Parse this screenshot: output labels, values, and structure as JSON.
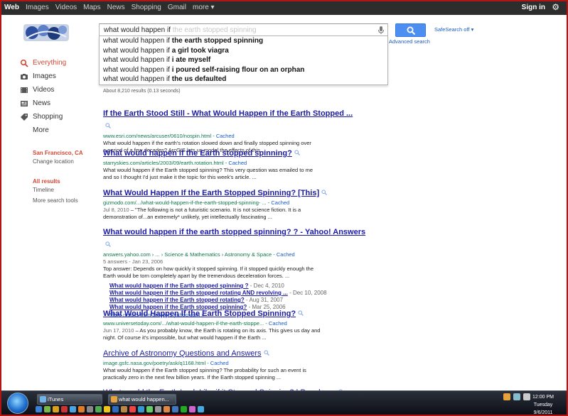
{
  "topbar": {
    "nav": [
      "Web",
      "Images",
      "Videos",
      "Maps",
      "News",
      "Shopping",
      "Gmail",
      "more ▾"
    ],
    "signin": "Sign in"
  },
  "search": {
    "typed": "what would happen if",
    "ghost": " the earth stopped spinning",
    "safesearch": "SafeSearch off ▾",
    "advanced": "Advanced search"
  },
  "suggestions": [
    {
      "prefix": "what would happen if ",
      "bold": "the earth stopped spinning"
    },
    {
      "prefix": "what would happen if ",
      "bold": "a girl took viagra"
    },
    {
      "prefix": "what would happen if ",
      "bold": "i ate myself"
    },
    {
      "prefix": "what would happen if ",
      "bold": "i poured self-raising flour on an orphan"
    },
    {
      "prefix": "what would happen if ",
      "bold": "the us defaulted"
    }
  ],
  "result_stats": "About 8,210 results (0.13 seconds)",
  "leftnav": {
    "items": [
      {
        "label": "Everything",
        "icon": "search-icon"
      },
      {
        "label": "Images",
        "icon": "camera-icon"
      },
      {
        "label": "Videos",
        "icon": "film-icon"
      },
      {
        "label": "News",
        "icon": "news-icon"
      },
      {
        "label": "Shopping",
        "icon": "tag-icon"
      },
      {
        "label": "More",
        "icon": ""
      }
    ],
    "location_city": "San Francisco, CA",
    "location_change": "Change location",
    "all_results": "All results",
    "timeline": "Timeline",
    "more_tools": "More search tools"
  },
  "results": [
    {
      "title": "If the Earth Stood Still - What Would Happen if the Earth Stopped ...",
      "url": "www.esri.com/news/arcuser/0610/nospin.html",
      "cached": "Cached",
      "snippet_l1": "What would happen if the earth's rotation slowed down and finally stopped spinning over",
      "snippet_l2": "a period of a few decades? ArcGIS lets us model the effects of this ..."
    },
    {
      "title": "What would happen if the Earth stopped spinning?",
      "url": "starryskies.com/articles/2003/09/earth.rotation.html",
      "cached": "Cached",
      "snippet_l1": "What would happen if the Earth stopped spinning? This very question was emailed to me",
      "snippet_l2": "and so I thought I'd just make it the topic for this week's article. ..."
    },
    {
      "title": "What Would Happen If the Earth Stopped Spinning? [This]",
      "url": "gizmodo.com/.../what-would-happen-if-the-earth-stopped-spinning- ...",
      "cached": "Cached",
      "date": "Jul 8, 2010",
      "snippet_l1": "\"The following is not a futuristic scenario. It is not science fiction. It is a",
      "snippet_l2": "demonstration of...an extremely* unlikely, yet intellectually fascinating ..."
    },
    {
      "title": "What would happen if the earth stopped spinning? ? - Yahoo! Answers",
      "url": "answers.yahoo.com › ... › Science & Mathematics › Astronomy & Space",
      "cached": "Cached",
      "meta": "5 answers - Jan 23, 2006",
      "snippet_l1": "Top answer: Depends on how quickly it stopped spinning. If it stopped quickly enough the",
      "snippet_l2": "Earth would be torn completely apart by the tremendous deceleration forces. ...",
      "subs": [
        {
          "link": "What would happen if the Earth stopped spinning ?",
          "date": "Dec 4, 2010"
        },
        {
          "link": "What would happen if the Earth stopped rotating AND revolving ...",
          "date": "Dec 10, 2008"
        },
        {
          "link": "What would happen if the Earth stopped rotating?",
          "date": "Aug 31, 2007"
        },
        {
          "link": "What would happen if the Earth stopped spinning?",
          "date": "Mar 25, 2006"
        }
      ],
      "more": "More results from answers.yahoo.com »"
    },
    {
      "title": "What Would Happen If the Earth Stopped Spinning?",
      "url": "www.universetoday.com/.../what-would-happen-if-the-earth-stoppe...",
      "cached": "Cached",
      "date": "Jun 17, 2010",
      "snippet_l1": "As you probably know, the Earth is rotating on its axis. This gives us day and",
      "snippet_l2": "night. Of course it's impossible, but what would happen if the Earth ..."
    },
    {
      "title": "Archive of Astronomy Questions and Answers",
      "url": "image.gsfc.nasa.gov/poetry/ask/q1168.html",
      "cached": "Cached",
      "snippet_l1": "What would happen if the Earth stopped spinning? The probability for such an event is",
      "snippet_l2": "practically zero in the next few billion years. If the Earth stopped spinning ..."
    },
    {
      "title": "What would the Earth Look Like if it Stopped Spinning? | Popular ..."
    }
  ],
  "taskbar": {
    "buttons": [
      "iTunes",
      "what would happen..."
    ],
    "time": "12:00 PM",
    "day": "Tuesday",
    "date": "9/6/2011"
  }
}
